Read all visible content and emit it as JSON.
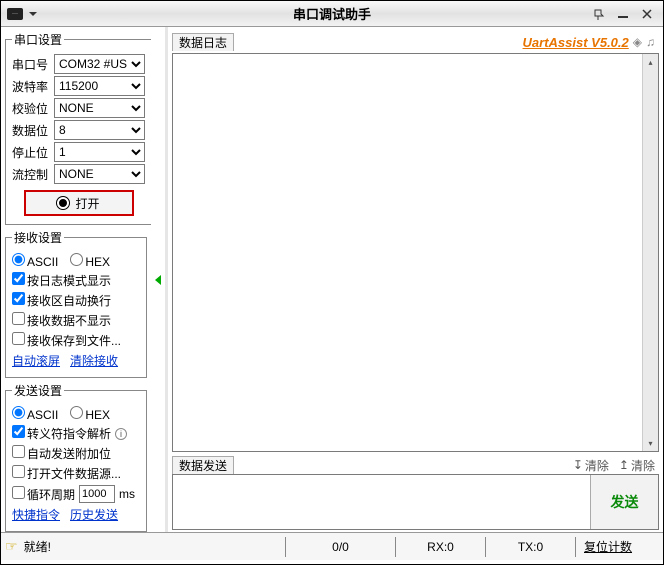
{
  "window": {
    "title": "串口调试助手"
  },
  "brand": {
    "text": "UartAssist V5.0.2"
  },
  "port_settings": {
    "legend": "串口设置",
    "rows": {
      "port": {
        "label": "串口号",
        "value": "COM32 #US"
      },
      "baud": {
        "label": "波特率",
        "value": "115200"
      },
      "check": {
        "label": "校验位",
        "value": "NONE"
      },
      "data": {
        "label": "数据位",
        "value": "8"
      },
      "stop": {
        "label": "停止位",
        "value": "1"
      },
      "flow": {
        "label": "流控制",
        "value": "NONE"
      }
    },
    "open_label": "打开"
  },
  "recv_settings": {
    "legend": "接收设置",
    "ascii": "ASCII",
    "hex": "HEX",
    "log_mode": {
      "label": "按日志模式显示",
      "checked": true
    },
    "auto_wrap": {
      "label": "接收区自动换行",
      "checked": true
    },
    "no_show": {
      "label": "接收数据不显示",
      "checked": false
    },
    "save_to_file": {
      "label": "接收保存到文件...",
      "checked": false
    },
    "auto_scroll_link": "自动滚屏",
    "clear_recv_link": "清除接收"
  },
  "send_settings": {
    "legend": "发送设置",
    "ascii": "ASCII",
    "hex": "HEX",
    "escape": {
      "label": "转义符指令解析",
      "checked": true
    },
    "auto_suffix": {
      "label": "自动发送附加位",
      "checked": false
    },
    "open_file": {
      "label": "打开文件数据源...",
      "checked": false
    },
    "loop": {
      "label": "循环周期",
      "checked": false,
      "value": "1000",
      "unit": "ms"
    },
    "quick_cmd_link": "快捷指令",
    "history_link": "历史发送"
  },
  "data_log": {
    "label": "数据日志"
  },
  "data_send": {
    "label": "数据发送",
    "tool_left": "清除",
    "tool_right": "清除",
    "send_btn": "发送"
  },
  "status": {
    "ready": "就绪!",
    "counter": "0/0",
    "rx": "RX:0",
    "tx": "TX:0",
    "reset": "复位计数"
  }
}
